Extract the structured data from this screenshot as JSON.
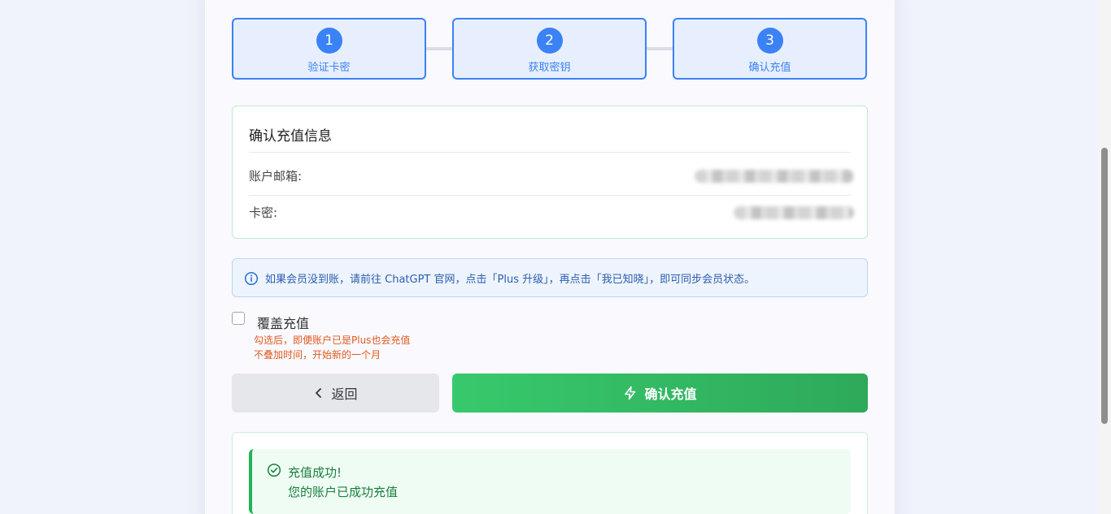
{
  "steps": [
    {
      "number": "1",
      "label": "验证卡密"
    },
    {
      "number": "2",
      "label": "获取密钥"
    },
    {
      "number": "3",
      "label": "确认充值"
    }
  ],
  "info": {
    "title": "确认充值信息",
    "email_label": "账户邮箱:",
    "card_label": "卡密:"
  },
  "notice": {
    "text": "如果会员没到账，请前往 ChatGPT 官网，点击「Plus 升级」，再点击「我已知晓」，即可同步会员状态。",
    "icon": "info-icon"
  },
  "override": {
    "label": "覆盖充值",
    "checked": false,
    "hint_line1": "勾选后，即便账户已是Plus也会充值",
    "hint_line2": "不叠加时间，开始新的一个月"
  },
  "buttons": {
    "back_label": "返回",
    "confirm_label": "确认充值"
  },
  "result": {
    "title": "充值成功!",
    "message": "您的账户已成功充值"
  },
  "colors": {
    "primary": "#3b82f6",
    "success": "#22b356",
    "warning_text": "#e05a1c"
  }
}
